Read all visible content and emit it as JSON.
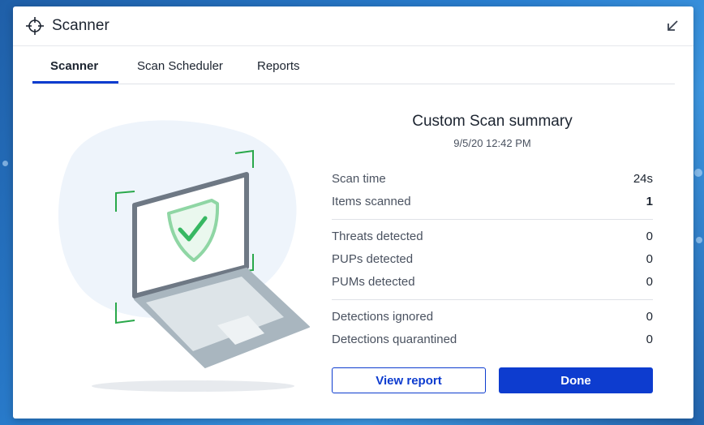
{
  "window": {
    "title": "Scanner",
    "icons": {
      "app": "crosshair-icon",
      "minimize": "arrow-down-left-icon"
    }
  },
  "tabs": [
    {
      "label": "Scanner",
      "active": true
    },
    {
      "label": "Scan Scheduler",
      "active": false
    },
    {
      "label": "Reports",
      "active": false
    }
  ],
  "summary": {
    "title": "Custom Scan summary",
    "date": "9/5/20 12:42 PM",
    "stats": [
      {
        "label": "Scan time",
        "value": "24s"
      },
      {
        "label": "Items scanned",
        "value": "1"
      },
      {
        "label": "Threats detected",
        "value": "0"
      },
      {
        "label": "PUPs detected",
        "value": "0"
      },
      {
        "label": "PUMs detected",
        "value": "0"
      },
      {
        "label": "Detections ignored",
        "value": "0"
      },
      {
        "label": "Detections quarantined",
        "value": "0"
      }
    ]
  },
  "buttons": {
    "view_report": "View report",
    "done": "Done"
  },
  "colors": {
    "accent": "#0d3ccf",
    "shield": "#3fbf6a",
    "frame_corners": "#29a84a"
  }
}
